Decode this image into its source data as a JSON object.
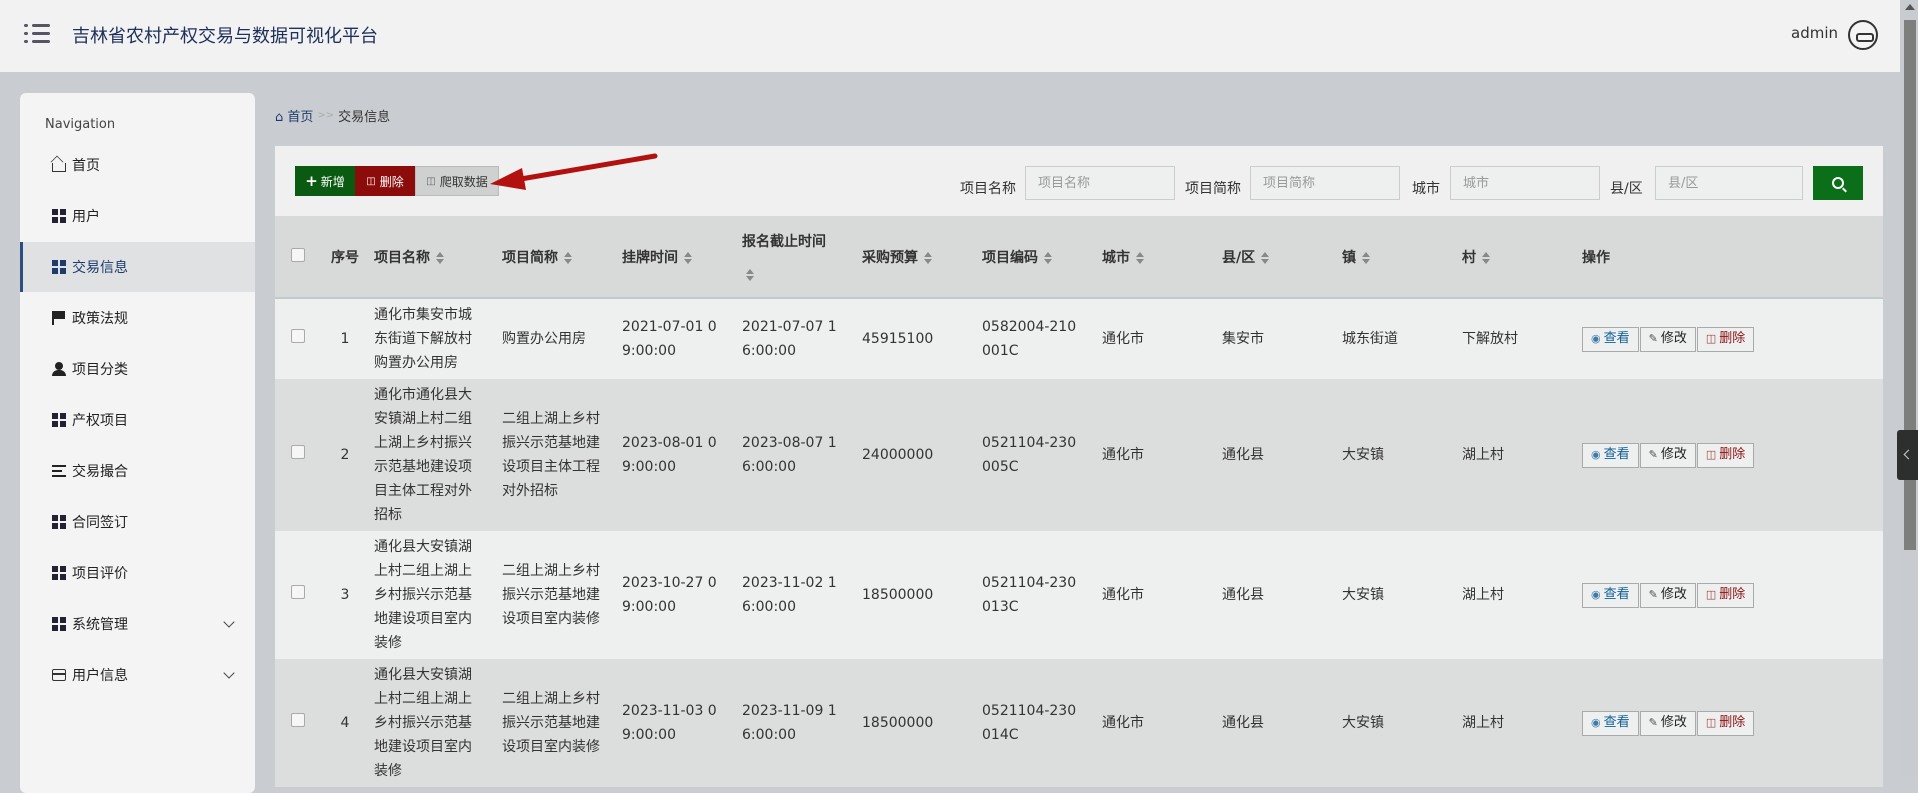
{
  "header": {
    "title": "吉林省农村产权交易与数据可视化平台",
    "user": "admin"
  },
  "sidebar": {
    "title": "Navigation",
    "items": [
      {
        "label": "首页",
        "icon": "home-icon"
      },
      {
        "label": "用户",
        "icon": "grid-icon"
      },
      {
        "label": "交易信息",
        "icon": "grid-icon",
        "active": true
      },
      {
        "label": "政策法规",
        "icon": "flag-icon"
      },
      {
        "label": "项目分类",
        "icon": "user-icon"
      },
      {
        "label": "产权项目",
        "icon": "grid-icon"
      },
      {
        "label": "交易撮合",
        "icon": "list-icon"
      },
      {
        "label": "合同签订",
        "icon": "grid-icon"
      },
      {
        "label": "项目评价",
        "icon": "grid-icon"
      },
      {
        "label": "系统管理",
        "icon": "grid-icon",
        "expandable": true
      },
      {
        "label": "用户信息",
        "icon": "card-icon",
        "expandable": true
      }
    ]
  },
  "breadcrumb": {
    "home": "首页",
    "sep": ">>",
    "current": "交易信息"
  },
  "toolbar": {
    "add": "新增",
    "delete": "删除",
    "crawl": "爬取数据"
  },
  "search": {
    "name_label": "项目名称",
    "name_placeholder": "项目名称",
    "short_label": "项目简称",
    "short_placeholder": "项目简称",
    "city_label": "城市",
    "city_placeholder": "城市",
    "county_label": "县/区",
    "county_placeholder": "县/区"
  },
  "table": {
    "headers": [
      "序号",
      "项目名称",
      "项目简称",
      "挂牌时间",
      "报名截止时间",
      "采购预算",
      "项目编码",
      "城市",
      "县/区",
      "镇",
      "村",
      "操作"
    ],
    "actions": {
      "view": "查看",
      "edit": "修改",
      "delete": "删除"
    },
    "rows": [
      [
        "1",
        "通化市集安市城东街道下解放村购置办公用房",
        "购置办公用房",
        "2021-07-01 09:00:00",
        "2021-07-07 16:00:00",
        "45915100",
        "0582004-210001C",
        "通化市",
        "集安市",
        "城东街道",
        "下解放村"
      ],
      [
        "2",
        "通化市通化县大安镇湖上村二组上湖上乡村振兴示范基地建设项目主体工程对外招标",
        "二组上湖上乡村振兴示范基地建设项目主体工程对外招标",
        "2023-08-01 09:00:00",
        "2023-08-07 16:00:00",
        "24000000",
        "0521104-230005C",
        "通化市",
        "通化县",
        "大安镇",
        "湖上村"
      ],
      [
        "3",
        "通化县大安镇湖上村二组上湖上乡村振兴示范基地建设项目室内装修",
        "二组上湖上乡村振兴示范基地建设项目室内装修",
        "2023-10-27 09:00:00",
        "2023-11-02 16:00:00",
        "18500000",
        "0521104-230013C",
        "通化市",
        "通化县",
        "大安镇",
        "湖上村"
      ],
      [
        "4",
        "通化县大安镇湖上村二组上湖上乡村振兴示范基地建设项目室内装修",
        "二组上湖上乡村振兴示范基地建设项目室内装修",
        "2023-11-03 09:00:00",
        "2023-11-09 16:00:00",
        "18500000",
        "0521104-230014C",
        "通化市",
        "通化县",
        "大安镇",
        "湖上村"
      ]
    ]
  }
}
